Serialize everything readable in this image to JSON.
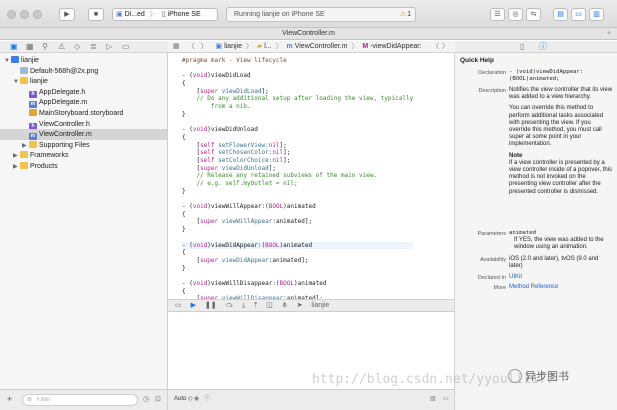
{
  "toolbar": {
    "run_icon": "play-icon",
    "stop_icon": "stop-icon",
    "scheme_name": "Di...ed",
    "device_name": "iPhone SE",
    "status_text": "Running lianjie on iPhone SE",
    "warning_count": "1"
  },
  "tab": {
    "title": "ViewController.m",
    "add": "+"
  },
  "jumpbar": {
    "project": "lianjie",
    "group": "l...",
    "file": "ViewController.m",
    "method": "-viewDidAppear:"
  },
  "navigator": {
    "rows": [
      {
        "label": "lianjie",
        "icon": "project-icon",
        "level": 0,
        "disclosure": "▼",
        "selected": false
      },
      {
        "label": "Default-568h@2x.png",
        "icon": "png-icon",
        "level": 1,
        "disclosure": "",
        "selected": false
      },
      {
        "label": "lianjie",
        "icon": "folder-icon",
        "level": 1,
        "disclosure": "▼",
        "selected": false
      },
      {
        "label": "AppDelegate.h",
        "icon": "header-file-icon",
        "level": 2,
        "disclosure": "",
        "selected": false
      },
      {
        "label": "AppDelegate.m",
        "icon": "source-file-icon",
        "level": 2,
        "disclosure": "",
        "selected": false
      },
      {
        "label": "MainStoryboard.storyboard",
        "icon": "storyboard-icon",
        "level": 2,
        "disclosure": "",
        "selected": false
      },
      {
        "label": "ViewController.h",
        "icon": "header-file-icon",
        "level": 2,
        "disclosure": "",
        "selected": false
      },
      {
        "label": "ViewController.m",
        "icon": "source-file-icon",
        "level": 2,
        "disclosure": "",
        "selected": true
      },
      {
        "label": "Supporting Files",
        "icon": "folder-icon",
        "level": 2,
        "disclosure": "▶",
        "selected": false
      },
      {
        "label": "Frameworks",
        "icon": "folder-icon",
        "level": 1,
        "disclosure": "▶",
        "selected": false
      },
      {
        "label": "Products",
        "icon": "folder-icon",
        "level": 1,
        "disclosure": "▶",
        "selected": false
      }
    ],
    "filter_placeholder": "Filter",
    "add_label": "+"
  },
  "code_lines": [
    [
      {
        "t": "#pragma mark - View lifecycle",
        "c": "pp"
      }
    ],
    [],
    [
      {
        "t": "- (",
        "c": ""
      },
      {
        "t": "void",
        "c": "kw"
      },
      {
        "t": ")viewDidLoad",
        "c": ""
      }
    ],
    [
      {
        "t": "{",
        "c": ""
      }
    ],
    [
      {
        "t": "    [",
        "c": ""
      },
      {
        "t": "super",
        "c": "kw"
      },
      {
        "t": " ",
        "c": ""
      },
      {
        "t": "viewDidLoad",
        "c": "fn"
      },
      {
        "t": "];",
        "c": ""
      }
    ],
    [
      {
        "t": "    // Do any additional setup after loading the view, typically",
        "c": "cm"
      }
    ],
    [
      {
        "t": "        from a nib.",
        "c": "cm"
      }
    ],
    [
      {
        "t": "}",
        "c": ""
      }
    ],
    [],
    [
      {
        "t": "- (",
        "c": ""
      },
      {
        "t": "void",
        "c": "kw"
      },
      {
        "t": ")viewDidUnload",
        "c": ""
      }
    ],
    [
      {
        "t": "{",
        "c": ""
      }
    ],
    [
      {
        "t": "    [",
        "c": ""
      },
      {
        "t": "self",
        "c": "kw"
      },
      {
        "t": " setFlowerView:",
        "c": "fn"
      },
      {
        "t": "nil",
        "c": "kw"
      },
      {
        "t": "];",
        "c": ""
      }
    ],
    [
      {
        "t": "    [",
        "c": ""
      },
      {
        "t": "self",
        "c": "kw"
      },
      {
        "t": " setChosenColor:",
        "c": "fn"
      },
      {
        "t": "nil",
        "c": "kw"
      },
      {
        "t": "];",
        "c": ""
      }
    ],
    [
      {
        "t": "    [",
        "c": ""
      },
      {
        "t": "self",
        "c": "kw"
      },
      {
        "t": " setColorChoice:",
        "c": "fn"
      },
      {
        "t": "nil",
        "c": "kw"
      },
      {
        "t": "];",
        "c": ""
      }
    ],
    [
      {
        "t": "    [",
        "c": ""
      },
      {
        "t": "super",
        "c": "kw"
      },
      {
        "t": " ",
        "c": ""
      },
      {
        "t": "viewDidUnload",
        "c": "fn"
      },
      {
        "t": "];",
        "c": ""
      }
    ],
    [
      {
        "t": "    // Release any retained subviews of the main view.",
        "c": "cm"
      }
    ],
    [
      {
        "t": "    // e.g. self.myOutlet = nil;",
        "c": "cm"
      }
    ],
    [
      {
        "t": "}",
        "c": ""
      }
    ],
    [],
    [
      {
        "t": "- (",
        "c": ""
      },
      {
        "t": "void",
        "c": "kw"
      },
      {
        "t": ")viewWillAppear:(",
        "c": ""
      },
      {
        "t": "BOOL",
        "c": "kw"
      },
      {
        "t": ")animated",
        "c": ""
      }
    ],
    [
      {
        "t": "{",
        "c": ""
      }
    ],
    [
      {
        "t": "    [",
        "c": ""
      },
      {
        "t": "super",
        "c": "kw"
      },
      {
        "t": " ",
        "c": ""
      },
      {
        "t": "viewWillAppear",
        "c": "fn"
      },
      {
        "t": ":animated];",
        "c": ""
      }
    ],
    [
      {
        "t": "}",
        "c": ""
      }
    ],
    [],
    [
      {
        "t": "- (",
        "c": ""
      },
      {
        "t": "void",
        "c": "kw"
      },
      {
        "t": ")viewDidAppear:(",
        "c": ""
      },
      {
        "t": "BOOL",
        "c": "kw"
      },
      {
        "t": ")animated",
        "c": ""
      }
    ],
    [
      {
        "t": "{",
        "c": ""
      }
    ],
    [
      {
        "t": "    [",
        "c": ""
      },
      {
        "t": "super",
        "c": "kw"
      },
      {
        "t": " ",
        "c": ""
      },
      {
        "t": "viewDidAppear",
        "c": "fn"
      },
      {
        "t": ":animated];",
        "c": ""
      }
    ],
    [
      {
        "t": "}",
        "c": ""
      }
    ],
    [],
    [
      {
        "t": "- (",
        "c": ""
      },
      {
        "t": "void",
        "c": "kw"
      },
      {
        "t": ")viewWillDisappear:(",
        "c": ""
      },
      {
        "t": "BOOL",
        "c": "kw"
      },
      {
        "t": ")animated",
        "c": ""
      }
    ],
    [
      {
        "t": "{",
        "c": ""
      }
    ],
    [
      {
        "t": "    [",
        "c": ""
      },
      {
        "t": "super",
        "c": "kw"
      },
      {
        "t": " ",
        "c": ""
      },
      {
        "t": "viewWillDisappear",
        "c": "fn"
      },
      {
        "t": ":animated];",
        "c": ""
      }
    ],
    [
      {
        "t": "}",
        "c": ""
      }
    ]
  ],
  "debugbar": {
    "target": "lianjie"
  },
  "debugfoot": {
    "mode": "Auto ◇"
  },
  "quick_help": {
    "title": "Quick Help",
    "declaration_label": "Declaration",
    "declaration": "- (void)viewDidAppear:(BOOL)animated;",
    "description_label": "Description",
    "description_1": "Notifies the view controller that its view was added to a view hierarchy.",
    "description_2": "You can override this method to perform additional tasks associated with presenting the view. If you override this method, you must call super at some point in your implementation.",
    "note_title": "Note",
    "note": "If a view controller is presented by a view controller inside of a popover, this method is not invoked on the presenting view controller after the presented controller is dismissed.",
    "parameters_label": "Parameters",
    "param_name": "animated",
    "param_desc": "If YES, the view was added to the window using an animation.",
    "availability_label": "Availability",
    "availability": "iOS (2.0 and later), tvOS (9.0 and later)",
    "declared_in_label": "Declared In",
    "declared_in": "UIKit",
    "more_label": "More",
    "more": "Method Reference"
  },
  "watermark": {
    "url": "http://blog.csdn.net/yyouli1177",
    "badge": "异步图书"
  }
}
